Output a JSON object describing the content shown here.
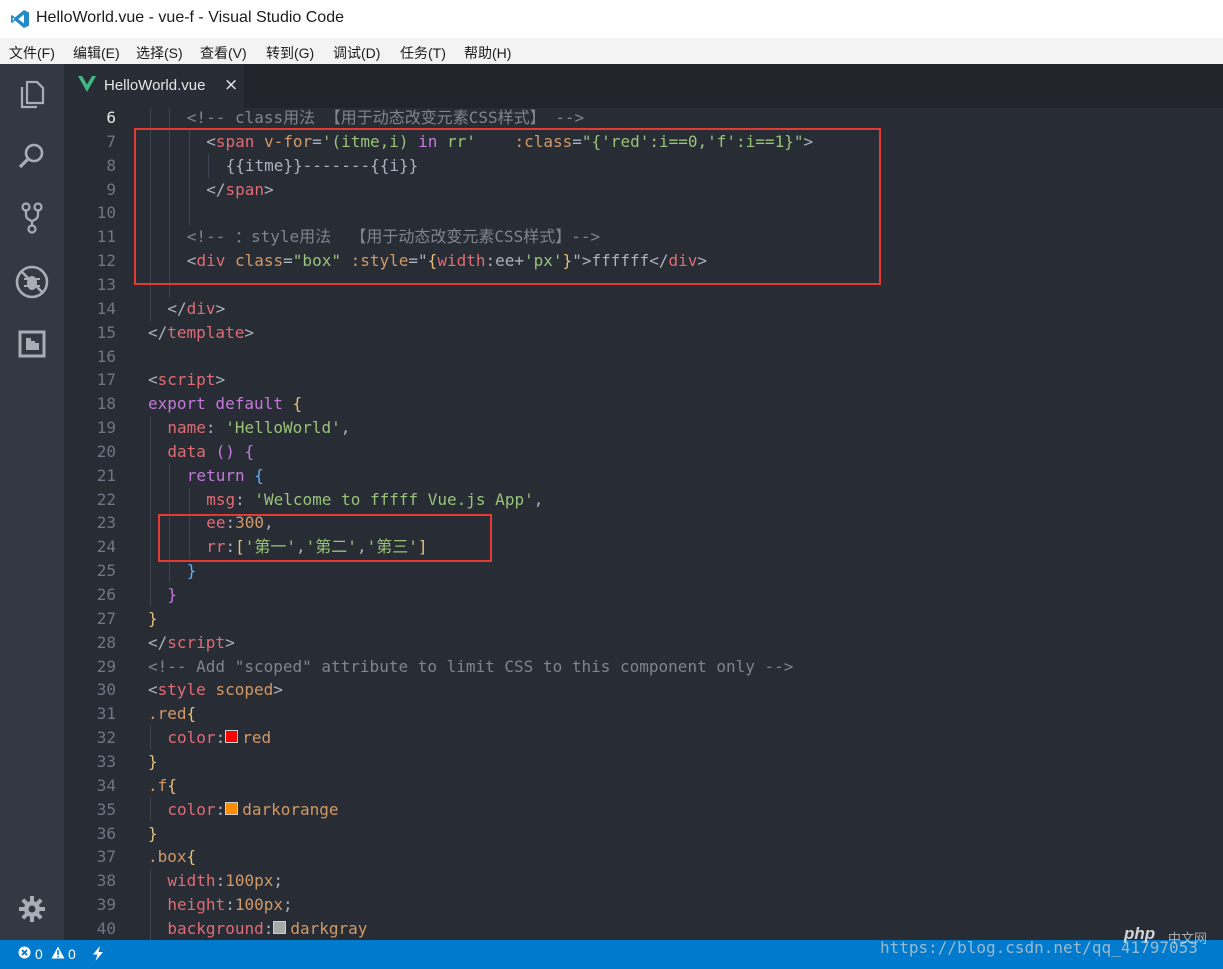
{
  "window": {
    "title": "HelloWorld.vue - vue-f - Visual Studio Code"
  },
  "menu": [
    "文件(F)",
    "编辑(E)",
    "选择(S)",
    "查看(V)",
    "转到(G)",
    "调试(D)",
    "任务(T)",
    "帮助(H)"
  ],
  "activity_icons": [
    "explorer-icon",
    "search-icon",
    "source-control-icon",
    "debug-icon",
    "extensions-icon",
    "gear-icon"
  ],
  "tab": {
    "label": "HelloWorld.vue",
    "close": "×"
  },
  "editor": {
    "current_line": 6,
    "lines": [
      {
        "n": 6,
        "indent": 2,
        "tokens": [
          [
            "cm",
            "<!-- class用法 【用于动态改变元素CSS样式】 -->"
          ]
        ]
      },
      {
        "n": 7,
        "indent": 3,
        "tokens": [
          [
            "pl",
            "<"
          ],
          [
            "tg",
            "span"
          ],
          [
            "pl",
            " "
          ],
          [
            "at",
            "v-for"
          ],
          [
            "pl",
            "="
          ],
          [
            "st",
            "'(itme,i) "
          ],
          [
            "kw",
            "in"
          ],
          [
            "st",
            " rr'"
          ],
          [
            "pl",
            "    "
          ],
          [
            "at",
            ":class"
          ],
          [
            "pl",
            "="
          ],
          [
            "st",
            "\"{'red':i==0,'f':i==1}\""
          ],
          [
            "pl",
            ">"
          ]
        ]
      },
      {
        "n": 8,
        "indent": 4,
        "tokens": [
          [
            "pl",
            "{{itme}}-------{{i}}"
          ]
        ]
      },
      {
        "n": 9,
        "indent": 3,
        "tokens": [
          [
            "pl",
            "</"
          ],
          [
            "tg",
            "span"
          ],
          [
            "pl",
            ">"
          ]
        ]
      },
      {
        "n": 10,
        "indent": 0,
        "tokens": []
      },
      {
        "n": 11,
        "indent": 2,
        "tokens": [
          [
            "cm",
            "<!-- ：style用法  【用于动态改变元素CSS样式】-->"
          ]
        ]
      },
      {
        "n": 12,
        "indent": 2,
        "tokens": [
          [
            "pl",
            "<"
          ],
          [
            "tg",
            "div"
          ],
          [
            "pl",
            " "
          ],
          [
            "at",
            "class"
          ],
          [
            "pl",
            "="
          ],
          [
            "st",
            "\"box\""
          ],
          [
            "pl",
            " "
          ],
          [
            "at",
            ":style"
          ],
          [
            "pl",
            "=\""
          ],
          [
            "br",
            "{"
          ],
          [
            "pr",
            "width"
          ],
          [
            "pl",
            ":ee+"
          ],
          [
            "st",
            "'px'"
          ],
          [
            "br",
            "}"
          ],
          [
            "pl",
            "\">ffffff</"
          ],
          [
            "tg",
            "div"
          ],
          [
            "pl",
            ">"
          ]
        ]
      },
      {
        "n": 13,
        "indent": 0,
        "tokens": []
      },
      {
        "n": 14,
        "indent": 1,
        "tokens": [
          [
            "pl",
            "</"
          ],
          [
            "tg",
            "div"
          ],
          [
            "pl",
            ">"
          ]
        ]
      },
      {
        "n": 15,
        "indent": 0,
        "tokens": [
          [
            "pl",
            "</"
          ],
          [
            "tg",
            "template"
          ],
          [
            "pl",
            ">"
          ]
        ]
      },
      {
        "n": 16,
        "indent": 0,
        "tokens": []
      },
      {
        "n": 17,
        "indent": 0,
        "tokens": [
          [
            "pl",
            "<"
          ],
          [
            "tg",
            "script"
          ],
          [
            "pl",
            ">"
          ]
        ]
      },
      {
        "n": 18,
        "indent": 0,
        "tokens": [
          [
            "kw",
            "export default"
          ],
          [
            "pl",
            " "
          ],
          [
            "br",
            "{"
          ]
        ]
      },
      {
        "n": 19,
        "indent": 1,
        "tokens": [
          [
            "pr",
            "name"
          ],
          [
            "pl",
            ": "
          ],
          [
            "st",
            "'HelloWorld'"
          ],
          [
            "pl",
            ","
          ]
        ]
      },
      {
        "n": 20,
        "indent": 1,
        "tokens": [
          [
            "pr",
            "data"
          ],
          [
            "pl",
            " "
          ],
          [
            "kw",
            "()"
          ],
          [
            "pl",
            " "
          ],
          [
            "kw",
            "{"
          ]
        ]
      },
      {
        "n": 21,
        "indent": 2,
        "tokens": [
          [
            "kw",
            "return"
          ],
          [
            "pl",
            " "
          ],
          [
            "fn",
            "{"
          ]
        ]
      },
      {
        "n": 22,
        "indent": 3,
        "tokens": [
          [
            "pr",
            "msg"
          ],
          [
            "pl",
            ": "
          ],
          [
            "st",
            "'Welcome to fffff Vue.js App'"
          ],
          [
            "pl",
            ","
          ]
        ]
      },
      {
        "n": 23,
        "indent": 3,
        "tokens": [
          [
            "pr",
            "ee"
          ],
          [
            "pl",
            ":"
          ],
          [
            "nm",
            "300"
          ],
          [
            "pl",
            ","
          ]
        ]
      },
      {
        "n": 24,
        "indent": 3,
        "tokens": [
          [
            "pr",
            "rr"
          ],
          [
            "pl",
            ":"
          ],
          [
            "br",
            "["
          ],
          [
            "st",
            "'第一'"
          ],
          [
            "pl",
            ","
          ],
          [
            "st",
            "'第二'"
          ],
          [
            "pl",
            ","
          ],
          [
            "st",
            "'第三'"
          ],
          [
            "br",
            "]"
          ]
        ]
      },
      {
        "n": 25,
        "indent": 2,
        "tokens": [
          [
            "fn",
            "}"
          ]
        ]
      },
      {
        "n": 26,
        "indent": 1,
        "tokens": [
          [
            "kw",
            "}"
          ]
        ]
      },
      {
        "n": 27,
        "indent": 0,
        "tokens": [
          [
            "br",
            "}"
          ]
        ]
      },
      {
        "n": 28,
        "indent": 0,
        "tokens": [
          [
            "pl",
            "</"
          ],
          [
            "tg",
            "script"
          ],
          [
            "pl",
            ">"
          ]
        ]
      },
      {
        "n": 29,
        "indent": 0,
        "tokens": [
          [
            "cm",
            "<!-- Add \"scoped\" attribute to limit CSS to this component only -->"
          ]
        ]
      },
      {
        "n": 30,
        "indent": 0,
        "tokens": [
          [
            "pl",
            "<"
          ],
          [
            "tg",
            "style"
          ],
          [
            "pl",
            " "
          ],
          [
            "at",
            "scoped"
          ],
          [
            "pl",
            ">"
          ]
        ]
      },
      {
        "n": 31,
        "indent": 0,
        "tokens": [
          [
            "sel",
            ".red"
          ],
          [
            "br",
            "{"
          ]
        ]
      },
      {
        "n": 32,
        "indent": 1,
        "tokens": [
          [
            "pr",
            "color"
          ],
          [
            "pl",
            ":"
          ],
          [
            "sw",
            "#ff0000"
          ],
          [
            "at",
            "red"
          ]
        ]
      },
      {
        "n": 33,
        "indent": 0,
        "tokens": [
          [
            "br",
            "}"
          ]
        ]
      },
      {
        "n": 34,
        "indent": 0,
        "tokens": [
          [
            "sel",
            ".f"
          ],
          [
            "br",
            "{"
          ]
        ]
      },
      {
        "n": 35,
        "indent": 1,
        "tokens": [
          [
            "pr",
            "color"
          ],
          [
            "pl",
            ":"
          ],
          [
            "sw",
            "#ff8c00"
          ],
          [
            "at",
            "darkorange"
          ]
        ]
      },
      {
        "n": 36,
        "indent": 0,
        "tokens": [
          [
            "br",
            "}"
          ]
        ]
      },
      {
        "n": 37,
        "indent": 0,
        "tokens": [
          [
            "sel",
            ".box"
          ],
          [
            "br",
            "{"
          ]
        ]
      },
      {
        "n": 38,
        "indent": 1,
        "tokens": [
          [
            "pr",
            "width"
          ],
          [
            "pl",
            ":"
          ],
          [
            "nm",
            "100px"
          ],
          [
            "pl",
            ";"
          ]
        ]
      },
      {
        "n": 39,
        "indent": 1,
        "tokens": [
          [
            "pr",
            "height"
          ],
          [
            "pl",
            ":"
          ],
          [
            "nm",
            "100px"
          ],
          [
            "pl",
            ";"
          ]
        ]
      },
      {
        "n": 40,
        "indent": 1,
        "tokens": [
          [
            "pr",
            "background"
          ],
          [
            "pl",
            ":"
          ],
          [
            "sw",
            "#a9a9a9"
          ],
          [
            "at",
            "darkgray"
          ]
        ]
      }
    ]
  },
  "status": {
    "errors": "0",
    "warnings": "0"
  },
  "watermark": {
    "url": "https://blog.csdn.net/qq_41797053",
    "site": "php",
    "site_cn": "中文网"
  },
  "colors": {
    "accent_statusbar": "#007acc",
    "highlight_box": "#e23b34",
    "editor_bg": "#282c34"
  }
}
